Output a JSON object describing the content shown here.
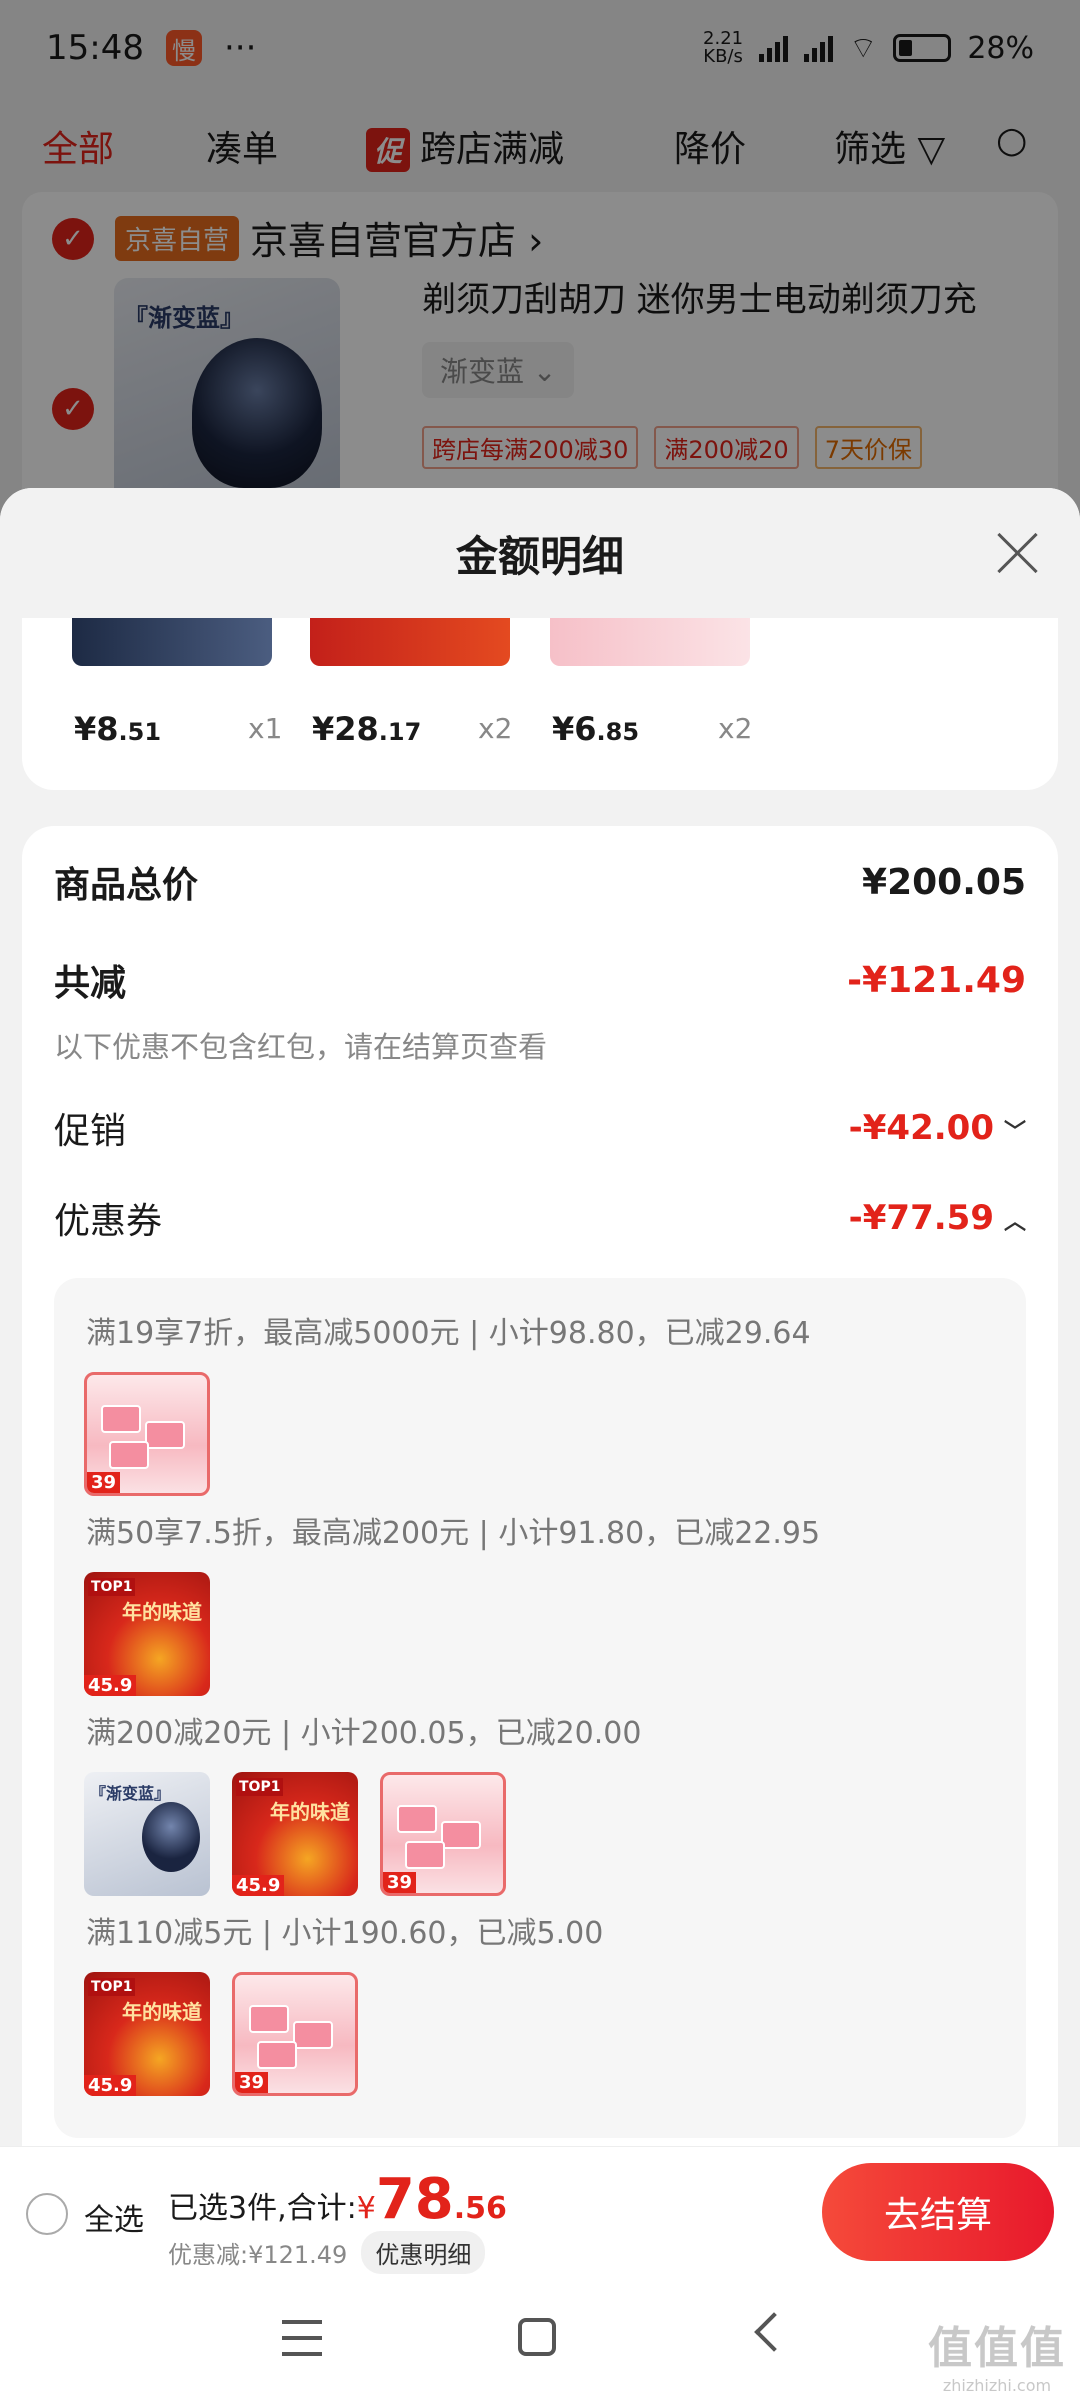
{
  "status_bar": {
    "time": "15:48",
    "app_badge": "慢",
    "dots": "···",
    "net_speed": "2.21\nKB/s",
    "battery": "28%"
  },
  "filter_tabs": {
    "all": "全部",
    "bundle": "凑单",
    "promo_tag": "促",
    "cross_store": "跨店满减",
    "price_drop": "降价",
    "filter": "筛选"
  },
  "store": {
    "tag": "京喜自营",
    "name": "京喜自营官方店",
    "product": {
      "image_label": "『渐变蓝』",
      "title": "剃须刀刮胡刀 迷你男士电动剃须刀充",
      "variant": "渐变蓝",
      "chips": [
        "跨店每满200减30",
        "满200减20",
        "7天价保"
      ]
    }
  },
  "sheet": {
    "title": "金额明细",
    "items": [
      {
        "price_int": "¥8",
        "price_dec": ".51",
        "qty": "x1"
      },
      {
        "price_int": "¥28",
        "price_dec": ".17",
        "qty": "x2"
      },
      {
        "price_int": "¥6",
        "price_dec": ".85",
        "qty": "x2"
      }
    ],
    "total_label": "商品总价",
    "total_value": "¥200.05",
    "reduce_label": "共减",
    "reduce_value": "-¥121.49",
    "reduce_hint": "以下优惠不包含红包，请在结算页查看",
    "promo_label": "促销",
    "promo_value": "-¥42.00",
    "coupon_label": "优惠券",
    "coupon_value": "-¥77.59",
    "coupons": [
      {
        "text": "满19享7折，最高减5000元 | 小计98.80，已减29.64"
      },
      {
        "text": "满50享7.5折，最高减200元 | 小计91.80，已减22.95"
      },
      {
        "text": "满200减20元 | 小计200.05，已减20.00"
      },
      {
        "text": "满110减5元 | 小计190.60，已减5.00"
      }
    ],
    "thumb_badges": {
      "pink": "39",
      "red": "45.9",
      "red_tag": "TOP1",
      "red_title": "年的味道",
      "gray_label": "『渐变蓝』"
    }
  },
  "checkout": {
    "select_all": "全选",
    "summary_prefix": "已选3件,合计:",
    "amount_sym": "¥",
    "amount_int": "78",
    "amount_dec": ".56",
    "discount_text": "优惠减:¥121.49",
    "detail_link": "优惠明细",
    "button": "去结算"
  },
  "watermark": {
    "big": "值值值",
    "small": "zhizhizhi.com"
  },
  "colors": {
    "accent_red": "#e2231a",
    "store_tag_orange": "#e76c1e"
  }
}
